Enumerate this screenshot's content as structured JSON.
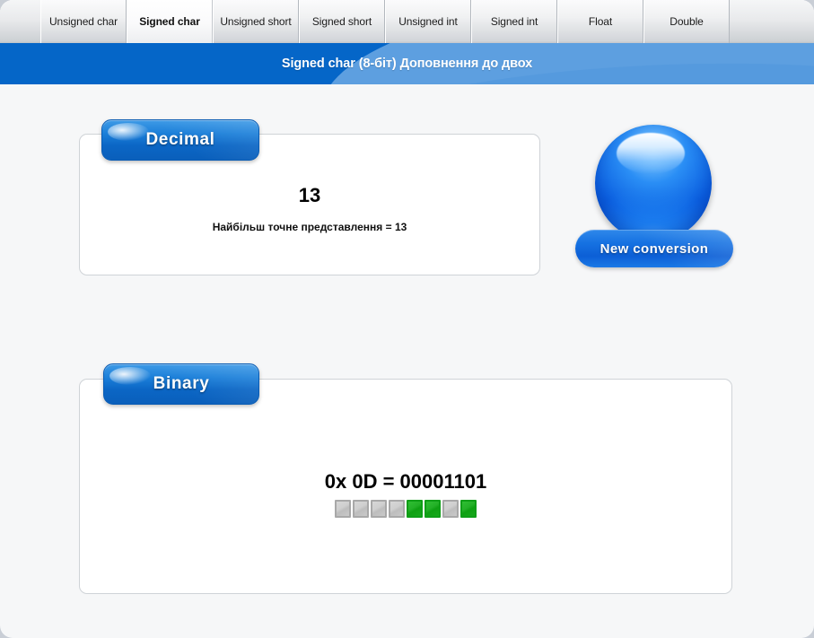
{
  "window": {
    "accent_blue": "#0566c8",
    "wave_blue": "#5d9fe0",
    "content_bg": "#f6f7f8"
  },
  "tabs": {
    "active_index": 1,
    "items": [
      {
        "label": "Unsigned char"
      },
      {
        "label": "Signed char"
      },
      {
        "label": "Unsigned short"
      },
      {
        "label": "Signed short"
      },
      {
        "label": "Unsigned int"
      },
      {
        "label": "Signed int"
      },
      {
        "label": "Float"
      },
      {
        "label": "Double"
      }
    ]
  },
  "banner": {
    "title": "Signed char (8-біт) Доповнення до двох"
  },
  "decimal_panel": {
    "legend": "Decimal",
    "value": "13",
    "note": "Найбільш точне представлення = 13"
  },
  "binary_panel": {
    "legend": "Binary",
    "expression": "0x 0D = 00001101",
    "hex": "0x 0D",
    "bits_string": "00001101",
    "bits": [
      0,
      0,
      0,
      0,
      1,
      1,
      0,
      1
    ],
    "bit_on_color": "#16a81b",
    "bit_off_color": "#c9c9c9"
  },
  "new_conversion": {
    "label": "New conversion",
    "sphere_icon": "blue-sphere-icon"
  }
}
